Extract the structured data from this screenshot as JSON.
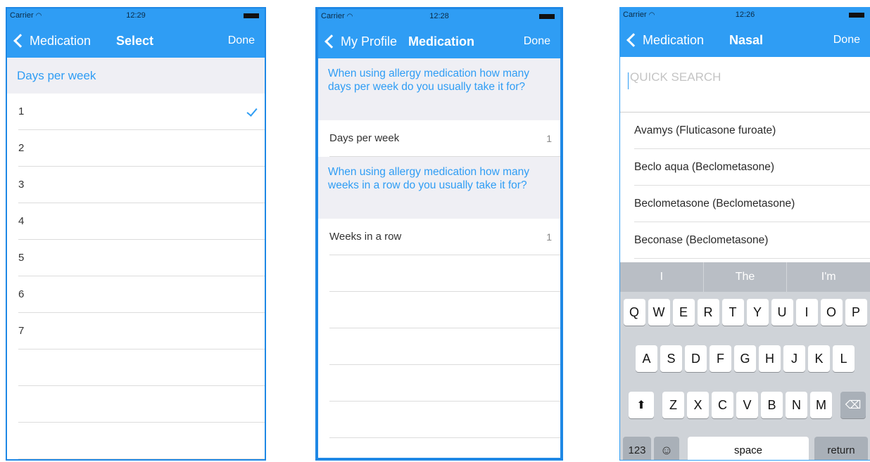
{
  "screens": [
    {
      "status": {
        "carrier": "Carrier",
        "time": "12:29"
      },
      "nav": {
        "back": "Medication",
        "title": "Select",
        "done": "Done"
      },
      "section": "Days per week",
      "options": [
        "1",
        "2",
        "3",
        "4",
        "5",
        "6",
        "7"
      ],
      "selected": "1"
    },
    {
      "status": {
        "carrier": "Carrier",
        "time": "12:28"
      },
      "nav": {
        "back": "My Profile",
        "title": "Medication",
        "done": "Done"
      },
      "q1": "When using allergy medication how many days per week do you usually take it for?",
      "row1": {
        "label": "Days per week",
        "value": "1"
      },
      "q2": "When using allergy medication how many weeks in a row do you usually take it for?",
      "row2": {
        "label": "Weeks in a row",
        "value": "1"
      }
    },
    {
      "status": {
        "carrier": "Carrier",
        "time": "12:26"
      },
      "nav": {
        "back": "Medication",
        "title": "Nasal",
        "done": "Done"
      },
      "search_placeholder": "QUICK SEARCH",
      "meds": [
        "Avamys (Fluticasone furoate)",
        "Beclo aqua (Beclometasone)",
        "Beclometasone (Beclometasone)",
        "Beconase (Beclometasone)"
      ],
      "keyboard": {
        "suggestions": [
          "I",
          "The",
          "I'm"
        ],
        "row1": [
          "Q",
          "W",
          "E",
          "R",
          "T",
          "Y",
          "U",
          "I",
          "O",
          "P"
        ],
        "row2": [
          "A",
          "S",
          "D",
          "F",
          "G",
          "H",
          "J",
          "K",
          "L"
        ],
        "row3": [
          "Z",
          "X",
          "C",
          "V",
          "B",
          "N",
          "M"
        ],
        "numbers": "123",
        "space": "space",
        "return": "return"
      }
    }
  ],
  "colors": {
    "accent": "#2f9df4",
    "section_bg": "#efeff4"
  }
}
